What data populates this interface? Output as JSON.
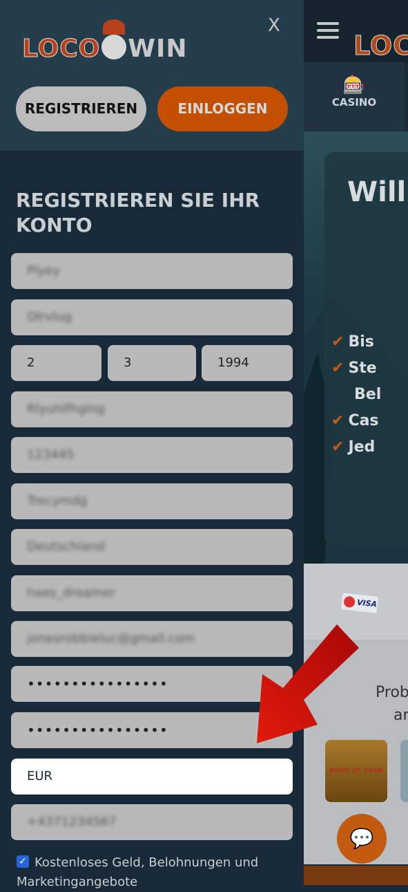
{
  "panel": {
    "logo": "LOCO WIN",
    "logo_left": "LOCO",
    "logo_right": "WIN",
    "close": "X",
    "register_button": "REGISTRIEREN",
    "login_button": "EINLOGGEN",
    "title": "REGISTRIEREN SIE IHR KONTO",
    "fields": {
      "first_name": "Plyey",
      "last_name": "Olrvlug",
      "day": "2",
      "month": "3",
      "year": "1994",
      "street": "Rlyuhlfhglng",
      "zip": "123445",
      "city": "Trecymdg",
      "country": "Deutschland",
      "username": "haes_dreamer",
      "email": "jonesrobbieluc@gmail.com",
      "password": "••••••••••••••••",
      "password_confirm": "••••••••••••••••",
      "currency": "EUR",
      "phone": "+4371234567"
    },
    "marketing_checkbox": {
      "checked": true,
      "label": "Kostenloses Geld, Belohnungen und Marketingangebote"
    }
  },
  "background": {
    "logo": "LOC",
    "nav_casino": "CASINO",
    "hero_title": "Will",
    "checks": [
      "Bis",
      "Ste",
      "Bel",
      "Cas",
      "Jed"
    ],
    "payment": "VISA",
    "promo_text_1": "Prob",
    "promo_text_2": "an",
    "game": "BOOK OF DEAD"
  },
  "colors": {
    "accent": "#c25000",
    "panel_bg": "#182a38",
    "header_bg": "#243d4b",
    "arrow": "#d01010"
  }
}
